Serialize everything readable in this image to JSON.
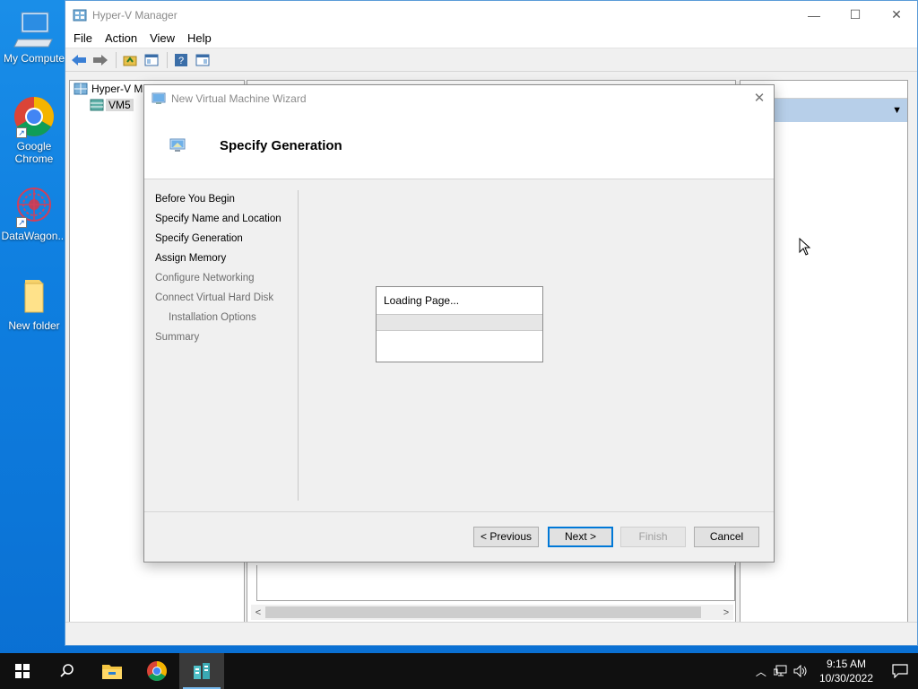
{
  "desktop": {
    "icons": [
      {
        "label": "My Compute",
        "icon": "computer-icon"
      },
      {
        "label": "Google Chrome",
        "icon": "chrome-icon"
      },
      {
        "label": "DataWagon...",
        "icon": "datawagon-icon"
      },
      {
        "label": "New folder",
        "icon": "folder-icon"
      }
    ]
  },
  "hyperv": {
    "title": "Hyper-V Manager",
    "menu": [
      "File",
      "Action",
      "View",
      "Help"
    ],
    "tree": {
      "root": "Hyper-V M",
      "child": "VM5"
    },
    "actions_header": "ns"
  },
  "wizard": {
    "title": "New Virtual Machine Wizard",
    "header": "Specify Generation",
    "steps": [
      {
        "label": "Before You Begin",
        "enabled": true
      },
      {
        "label": "Specify Name and Location",
        "enabled": true
      },
      {
        "label": "Specify Generation",
        "enabled": true
      },
      {
        "label": "Assign Memory",
        "enabled": true
      },
      {
        "label": "Configure Networking",
        "enabled": false
      },
      {
        "label": "Connect Virtual Hard Disk",
        "enabled": false
      },
      {
        "label": "Installation Options",
        "enabled": false
      },
      {
        "label": "Summary",
        "enabled": false
      }
    ],
    "loading_text": "Loading Page...",
    "buttons": {
      "previous": "< Previous",
      "next": "Next >",
      "finish": "Finish",
      "cancel": "Cancel"
    }
  },
  "taskbar": {
    "apps": [
      "start-icon",
      "search-icon",
      "file-explorer-icon",
      "chrome-icon",
      "hyperv-manager-icon"
    ],
    "time": "9:15 AM",
    "date": "10/30/2022"
  },
  "colors": {
    "desktop": "#0f7fe0",
    "taskbar": "#101010",
    "accent": "#0078d7"
  }
}
